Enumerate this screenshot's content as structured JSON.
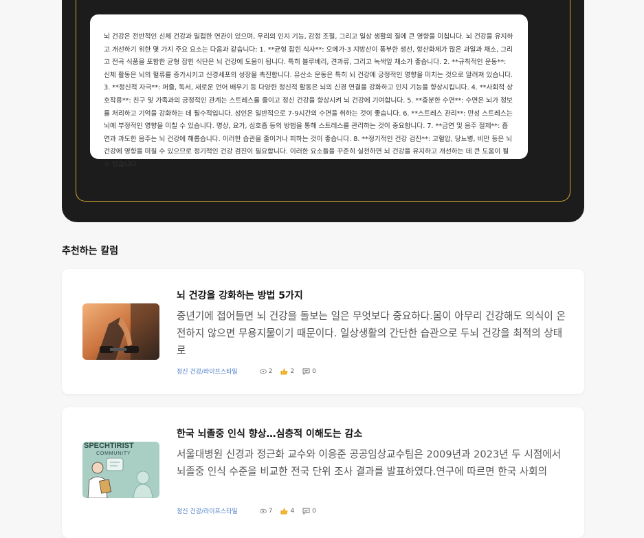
{
  "answer": {
    "text": "뇌 건강은 전반적인 신체 건강과 밀접한 연관이 있으며, 우리의 인지 기능, 감정 조절, 그리고 일상 생활의 질에 큰 영향을 미칩니다. 뇌 건강을 유지하고 개선하기 위한 몇 가지 주요 요소는 다음과 같습니다: 1. **균형 잡힌 식사**: 오메가-3 지방산이 풍부한 생선, 항산화제가 많은 과일과 채소, 그리고 전곡 식품을 포함한 균형 잡힌 식단은 뇌 건강에 도움이 됩니다. 특히 블루베리, 견과류, 그리고 녹색잎 채소가 좋습니다. 2. **규칙적인 운동**: 신체 활동은 뇌의 혈류를 증가시키고 신경세포의 성장을 촉진합니다. 유산소 운동은 특히 뇌 건강에 긍정적인 영향을 미치는 것으로 알려져 있습니다. 3. **정신적 자극**: 퍼즐, 독서, 새로운 언어 배우기 등 다양한 정신적 활동은 뇌의 신경 연결을 강화하고 인지 기능을 향상시킵니다. 4. **사회적 상호작용**: 친구 및 가족과의 긍정적인 관계는 스트레스를 줄이고 정신 건강을 향상시켜 뇌 건강에 기여합니다. 5. **충분한 수면**: 수면은 뇌가 정보를 처리하고 기억을 강화하는 데 필수적입니다. 성인은 일반적으로 7-9시간의 수면을 취하는 것이 좋습니다. 6. **스트레스 관리**: 만성 스트레스는 뇌에 부정적인 영향을 미칠 수 있습니다. 명상, 요가, 심호흡 등의 방법을 통해 스트레스를 관리하는 것이 중요합니다. 7. **금연 및 음주 절제**: 흡연과 과도한 음주는 뇌 건강에 해롭습니다. 이러한 습관을 줄이거나 피하는 것이 좋습니다. 8. **정기적인 건강 검진**: 고혈압, 당뇨병, 비만 등은 뇌 건강에 영향을 미칠 수 있으므로 정기적인 건강 검진이 필요합니다. 이러한 요소들을 꾸준히 실천하면 뇌 건강을 유지하고 개선하는 데 큰 도움이 될 수 있습니다."
  },
  "recommended": {
    "title": "추천하는 칼럼",
    "columns": [
      {
        "title": "뇌 건강을 강화하는 방법 5가지",
        "description": "중년기에 접어들면 뇌 건강을 돌보는 일은 무엇보다 중요하다.몸이 아무리 건강해도 의식이 온전하지 않으면 무용지물이기 때문이다. 일상생활의 간단한 습관으로 두뇌 건강을 최적의 상태로",
        "category": "정신 건강/라이프스타일",
        "views": "2",
        "likes": "2",
        "comments": "0",
        "thumb_icon": "dumbbell-workout-image"
      },
      {
        "title": "한국 뇌졸중 인식 향상…심층적 이해도는 감소",
        "description": "서울대병원 신경과 정근화 교수와 이응준 공공임상교수팀은 2009년과 2023년 두 시점에서 뇌졸중 인식 수준을 비교한 전국 단위 조사 결과를 발표하였다.연구에 따르면 한국 사회의",
        "category": "정신 건강/라이프스타일",
        "views": "7",
        "likes": "4",
        "comments": "0",
        "thumb_text_1": "SPECHTIRIST",
        "thumb_text_2": "COMMUNITY",
        "thumb_icon": "speech-therapist-illustration"
      }
    ]
  },
  "colors": {
    "dark_panel": "#1c1c1c",
    "gold_border": "#d4a72c",
    "category_link": "#4a7cc7"
  }
}
